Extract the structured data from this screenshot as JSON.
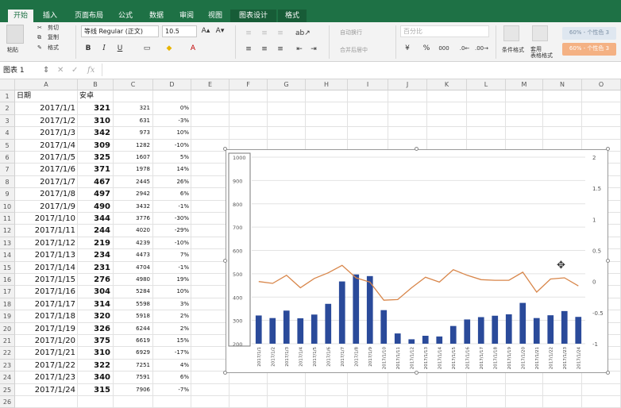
{
  "ribbon": {
    "tabs": [
      "开始",
      "插入",
      "页面布局",
      "公式",
      "数据",
      "审阅",
      "视图",
      "图表设计",
      "格式"
    ],
    "paste_label": "粘贴",
    "cut_label": "剪切",
    "copy_label": "复制",
    "format_label": "格式",
    "font_name": "等线 Regular (正文)",
    "font_size": "10.5",
    "wrap_label": "自动换行",
    "merge_label": "合并后居中",
    "number_format": "百分比",
    "cond_format_label": "条件格式",
    "table_format_label": "套用\n表格格式",
    "style_good": "60% - 个性色 3",
    "style_bad": "60% - 个性色 3"
  },
  "formula_bar": {
    "name_box": "图表 1",
    "fx": "fx"
  },
  "columns": [
    "A",
    "B",
    "C",
    "D",
    "E",
    "F",
    "G",
    "H",
    "I",
    "J",
    "K",
    "L",
    "M",
    "N",
    "O"
  ],
  "headers": {
    "a": "日期",
    "b": "安卓"
  },
  "rows": [
    {
      "date": "2017/1/1",
      "v": "321",
      "c": "321",
      "d": "0%"
    },
    {
      "date": "2017/1/2",
      "v": "310",
      "c": "631",
      "d": "-3%"
    },
    {
      "date": "2017/1/3",
      "v": "342",
      "c": "973",
      "d": "10%"
    },
    {
      "date": "2017/1/4",
      "v": "309",
      "c": "1282",
      "d": "-10%"
    },
    {
      "date": "2017/1/5",
      "v": "325",
      "c": "1607",
      "d": "5%"
    },
    {
      "date": "2017/1/6",
      "v": "371",
      "c": "1978",
      "d": "14%"
    },
    {
      "date": "2017/1/7",
      "v": "467",
      "c": "2445",
      "d": "26%"
    },
    {
      "date": "2017/1/8",
      "v": "497",
      "c": "2942",
      "d": "6%"
    },
    {
      "date": "2017/1/9",
      "v": "490",
      "c": "3432",
      "d": "-1%"
    },
    {
      "date": "2017/1/10",
      "v": "344",
      "c": "3776",
      "d": "-30%"
    },
    {
      "date": "2017/1/11",
      "v": "244",
      "c": "4020",
      "d": "-29%"
    },
    {
      "date": "2017/1/12",
      "v": "219",
      "c": "4239",
      "d": "-10%"
    },
    {
      "date": "2017/1/13",
      "v": "234",
      "c": "4473",
      "d": "7%"
    },
    {
      "date": "2017/1/14",
      "v": "231",
      "c": "4704",
      "d": "-1%"
    },
    {
      "date": "2017/1/15",
      "v": "276",
      "c": "4980",
      "d": "19%"
    },
    {
      "date": "2017/1/16",
      "v": "304",
      "c": "5284",
      "d": "10%"
    },
    {
      "date": "2017/1/17",
      "v": "314",
      "c": "5598",
      "d": "3%"
    },
    {
      "date": "2017/1/18",
      "v": "320",
      "c": "5918",
      "d": "2%"
    },
    {
      "date": "2017/1/19",
      "v": "326",
      "c": "6244",
      "d": "2%"
    },
    {
      "date": "2017/1/20",
      "v": "375",
      "c": "6619",
      "d": "15%"
    },
    {
      "date": "2017/1/21",
      "v": "310",
      "c": "6929",
      "d": "-17%"
    },
    {
      "date": "2017/1/22",
      "v": "322",
      "c": "7251",
      "d": "4%"
    },
    {
      "date": "2017/1/23",
      "v": "340",
      "c": "7591",
      "d": "6%"
    },
    {
      "date": "2017/1/24",
      "v": "315",
      "c": "7906",
      "d": "-7%"
    }
  ],
  "chart_data": {
    "type": "bar",
    "categories": [
      "2017/1/1",
      "2017/1/2",
      "2017/1/3",
      "2017/1/4",
      "2017/1/5",
      "2017/1/6",
      "2017/1/7",
      "2017/1/8",
      "2017/1/9",
      "2017/1/10",
      "2017/1/11",
      "2017/1/12",
      "2017/1/13",
      "2017/1/14",
      "2017/1/15",
      "2017/1/16",
      "2017/1/17",
      "2017/1/18",
      "2017/1/19",
      "2017/1/20",
      "2017/1/21",
      "2017/1/22",
      "2017/1/23",
      "2017/1/24"
    ],
    "series": [
      {
        "kind": "bar",
        "axis": "left",
        "color": "#2a4a9a",
        "values": [
          321,
          310,
          342,
          309,
          325,
          371,
          467,
          497,
          490,
          344,
          244,
          219,
          234,
          231,
          276,
          304,
          314,
          320,
          326,
          375,
          310,
          322,
          340,
          315
        ]
      },
      {
        "kind": "line",
        "axis": "right",
        "color": "#d8864a",
        "values": [
          0,
          -0.03,
          0.1,
          -0.1,
          0.05,
          0.14,
          0.26,
          0.06,
          -0.01,
          -0.3,
          -0.29,
          -0.1,
          0.07,
          -0.01,
          0.19,
          0.1,
          0.03,
          0.02,
          0.02,
          0.15,
          -0.17,
          0.04,
          0.06,
          -0.07
        ]
      }
    ],
    "y_left": {
      "ylim": [
        200,
        1000
      ],
      "ticks": [
        "200",
        "300",
        "400",
        "500",
        "600",
        "700",
        "800",
        "900",
        "1000"
      ]
    },
    "y_right": {
      "ylim": [
        -1,
        2
      ],
      "ticks": [
        "-1",
        "-0.5",
        "0",
        "0.5",
        "1",
        "1.5",
        "2"
      ]
    },
    "grid": true,
    "legend": "none"
  }
}
